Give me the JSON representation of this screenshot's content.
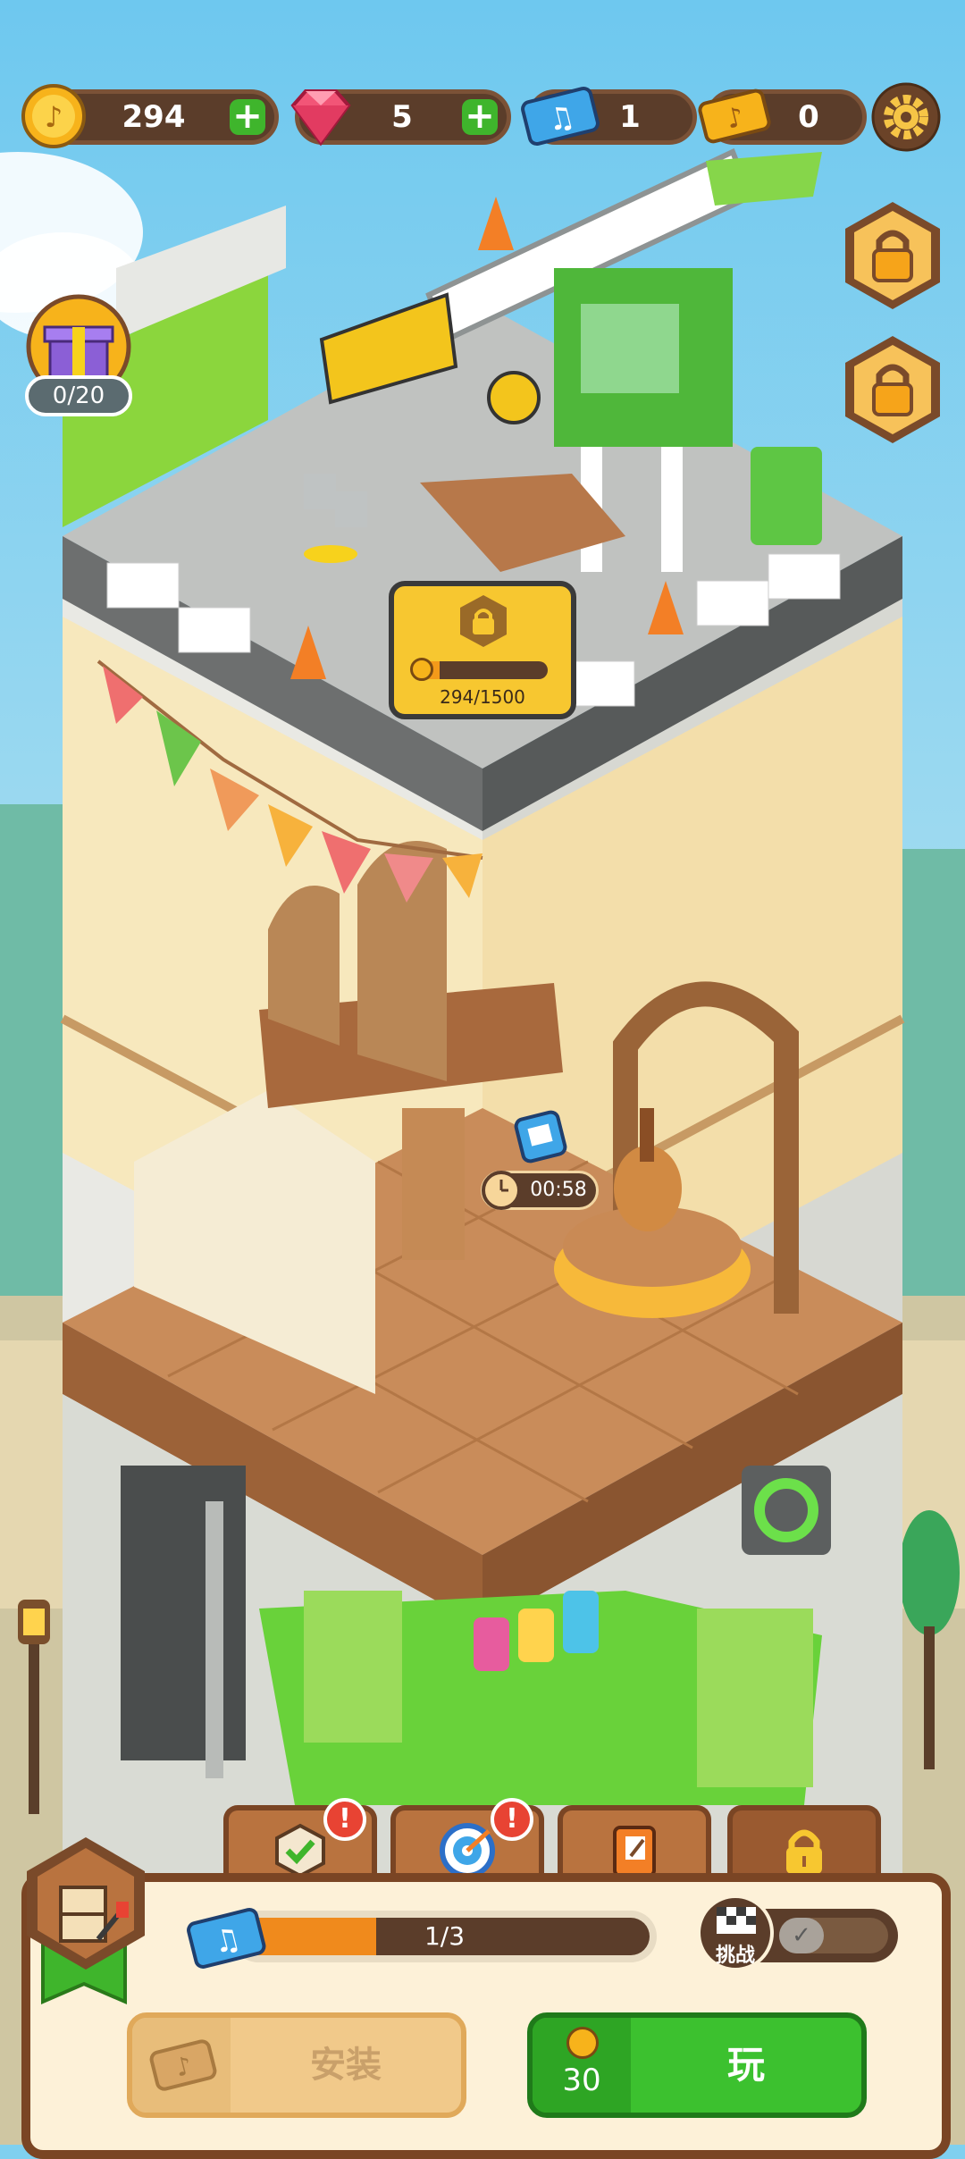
{
  "hud": {
    "coins": "294",
    "gems": "5",
    "music_tickets": "1",
    "gold_tickets": "0"
  },
  "gift_progress": "0/20",
  "construction": {
    "progress_text": "294/1500",
    "progress": 0.196
  },
  "timer": "00:58",
  "bottom": {
    "ticket_progress_text": "1/3",
    "ticket_progress": 0.333,
    "challenge_label": "挑战",
    "install_label": "安装",
    "play_label": "玩",
    "play_cost": "30"
  },
  "colors": {
    "sky": "#7fd0ef",
    "panel": "#fdf1d8",
    "play_green": "#3cc12f",
    "install_tan": "#f1c98a",
    "progress_orange": "#f08a1c"
  },
  "icons": [
    "coin-icon",
    "gem-icon",
    "music-ticket-icon",
    "gold-ticket-icon",
    "gear-icon",
    "lock-icon",
    "gift-icon",
    "check-icon",
    "target-icon",
    "book-icon",
    "furniture-icon",
    "clock-icon"
  ]
}
